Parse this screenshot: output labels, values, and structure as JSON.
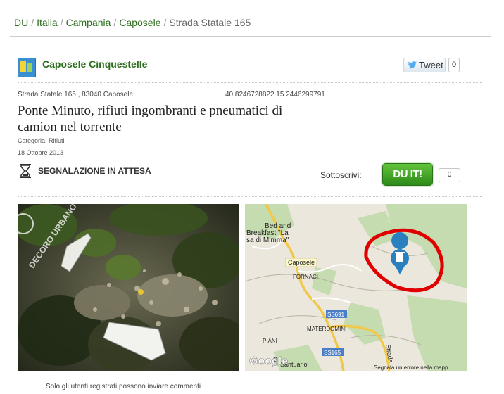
{
  "breadcrumb": {
    "items": [
      "DU",
      "Italia",
      "Campania",
      "Caposele",
      "Strada Statale 165"
    ],
    "separator": "/"
  },
  "author": {
    "name": "Caposele Cinquestelle",
    "icon": "author-avatar-icon"
  },
  "share": {
    "tweet_label": "Tweet",
    "tweet_count": "0",
    "icon": "twitter-bird-icon"
  },
  "report": {
    "address": "Strada Statale 165 , 83040 Caposele",
    "coordinates": "40.8246728822 15.2446299791",
    "title": "Ponte Minuto, rifiuti ingombranti e pneumatici di camion nel torrente",
    "category": "Categoria: Rifiuti",
    "date": "18 Ottobre 2013",
    "status": "SEGNALAZIONE IN ATTESA",
    "status_icon": "hourglass-icon"
  },
  "subscribe": {
    "label": "Sottoscrivi:",
    "button_label": "DU IT!",
    "count": "0"
  },
  "photo": {
    "watermark": "DECORO URBANO"
  },
  "map": {
    "labels": {
      "bnb_line1": "Bed and",
      "bnb_line2": "Breakfast \"La",
      "bnb_line3": "sa di Mimma\"",
      "caposele": "Caposele",
      "fornaci": "FORNACI",
      "materdomini": "MATERDOMINI",
      "piani": "PIANI",
      "santuario_1": "Santuario",
      "santuario_2": "S",
      "ss691": "SS691",
      "ss165": "SS165",
      "strada": "Strada",
      "google": "Google",
      "report_error": "Segnala un errore nella mapp"
    },
    "marker_icon": "trash-bin-marker-icon"
  },
  "comments_note": "Solo gli utenti registrati possono inviare commenti",
  "colors": {
    "brand_green": "#2c6e1e",
    "button_green": "#3ea824",
    "circle_red": "#e00000",
    "marker_blue": "#2a7fbf"
  }
}
